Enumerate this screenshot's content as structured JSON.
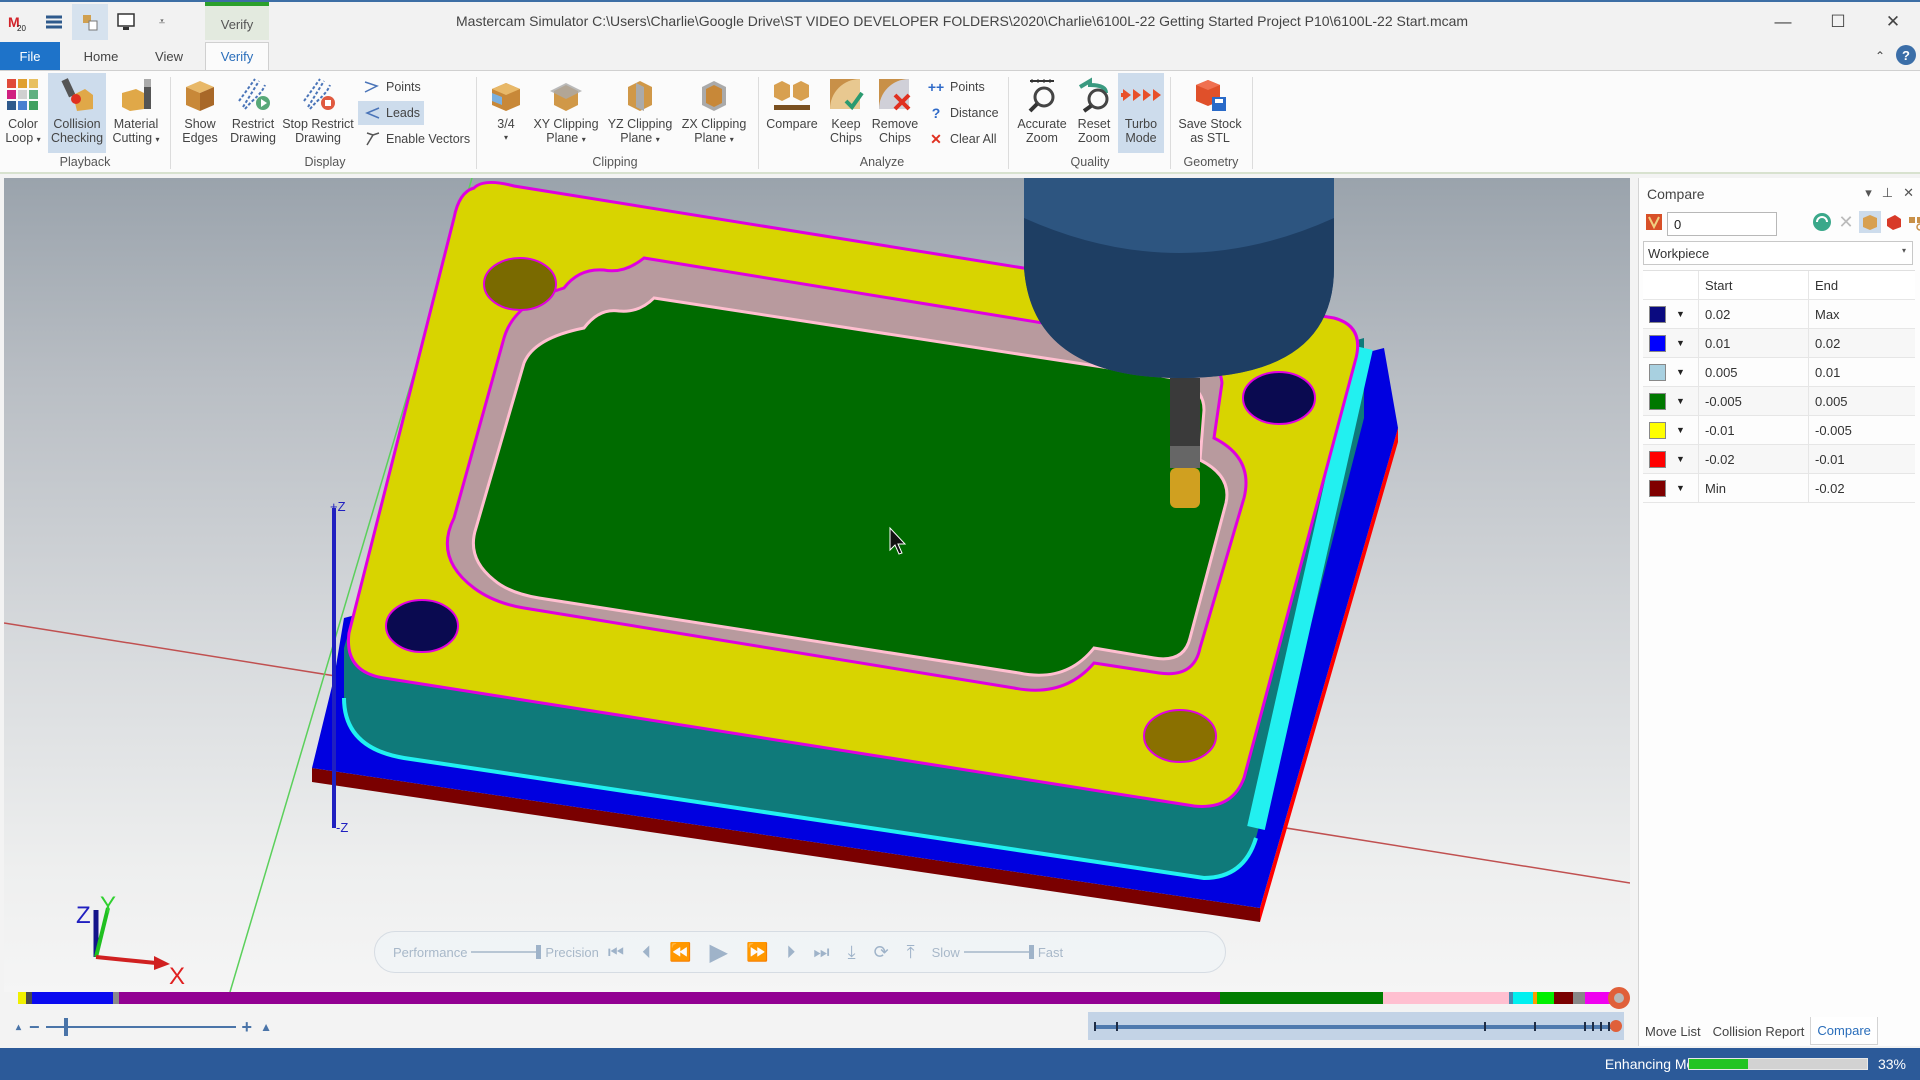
{
  "window": {
    "title": "Mastercam Simulator  C:\\Users\\Charlie\\Google Drive\\ST VIDEO DEVELOPER FOLDERS\\2020\\Charlie\\6100L-22 Getting Started Project P10\\6100L-22 Start.mcam",
    "context_tab": "Verify",
    "controls": {
      "minimize": "—",
      "maximize": "☐",
      "close": "✕"
    }
  },
  "quick_access": [
    {
      "icon": "mastercam-logo-icon"
    },
    {
      "icon": "layers-icon"
    },
    {
      "icon": "toolpath-icon"
    },
    {
      "icon": "display-icon"
    },
    {
      "icon": "customize-icon",
      "glyph": "⩡"
    }
  ],
  "menu": {
    "tabs": [
      "File",
      "Home",
      "View",
      "Verify"
    ],
    "active": "Verify",
    "collapse_glyph": "⌃",
    "help_glyph": "?"
  },
  "ribbon": {
    "groups": [
      "Playback",
      "Display",
      "Clipping",
      "Analyze",
      "Quality",
      "Geometry"
    ],
    "buttons": {
      "color_loop": [
        "Color",
        "Loop"
      ],
      "collision_checking": [
        "Collision",
        "Checking"
      ],
      "material_cutting": [
        "Material",
        "Cutting"
      ],
      "show_edges": [
        "Show",
        "Edges"
      ],
      "restrict_drawing": [
        "Restrict",
        "Drawing"
      ],
      "stop_restrict_drawing": [
        "Stop Restrict",
        "Drawing"
      ],
      "points": "Points",
      "leads": "Leads",
      "enable_vectors": "Enable Vectors",
      "three_quarter": "3/4",
      "xy_clipping": [
        "XY Clipping",
        "Plane"
      ],
      "yz_clipping": [
        "YZ Clipping",
        "Plane"
      ],
      "zx_clipping": [
        "ZX Clipping",
        "Plane"
      ],
      "compare": "Compare",
      "keep_chips": [
        "Keep",
        "Chips"
      ],
      "remove_chips": [
        "Remove",
        "Chips"
      ],
      "analyze_points": "Points",
      "distance": "Distance",
      "clear_all": "Clear All",
      "accurate_zoom": [
        "Accurate",
        "Zoom"
      ],
      "reset_zoom": [
        "Reset",
        "Zoom"
      ],
      "turbo_mode": [
        "Turbo",
        "Mode"
      ],
      "save_stock": [
        "Save Stock",
        "as STL"
      ]
    },
    "dropdown_glyph": "▾",
    "active_buttons": [
      "collision_checking",
      "leads",
      "turbo_mode"
    ]
  },
  "viewport": {
    "axis_labels": {
      "plus_z": "+Z",
      "minus_z": "-Z"
    },
    "triad": {
      "x": "X",
      "y": "Y",
      "z": "Z"
    },
    "colors": {
      "workpiece_top": "#d8d400",
      "pocket_floor": "#006b00",
      "pocket_wall": "#b89a9e",
      "side_teal": "#0f7a7a",
      "cyan": "#22f0f0",
      "blue": "#0000e0",
      "dark_red": "#7a0000",
      "red": "#ff0000",
      "magenta": "#e000e0",
      "tool_holder": "#2d5580"
    }
  },
  "playback": {
    "performance": "Performance",
    "precision": "Precision",
    "slow": "Slow",
    "fast": "Fast",
    "glyphs": [
      "⏮",
      "⏴",
      "⏪",
      "▶",
      "⏩",
      "⏵",
      "⏭",
      "⤓",
      "⟳",
      "⤒"
    ]
  },
  "timeline": {
    "segments": [
      {
        "color": "#f0f000",
        "share": 0.4
      },
      {
        "color": "#4a4a4a",
        "share": 0.3
      },
      {
        "color": "#0a0af0",
        "share": 4.2
      },
      {
        "color": "#8a8a8a",
        "share": 0.3
      },
      {
        "color": "#920092",
        "share": 56.8
      },
      {
        "color": "#007d00",
        "share": 8.4
      },
      {
        "color": "#ffbfd0",
        "share": 6.5
      },
      {
        "color": "#4a8ab0",
        "share": 0.2
      },
      {
        "color": "#00f0f0",
        "share": 1.0
      },
      {
        "color": "#ff9c00",
        "share": 0.2
      },
      {
        "color": "#00f000",
        "share": 0.9
      },
      {
        "color": "#7a0000",
        "share": 1.0
      },
      {
        "color": "#888888",
        "share": 0.6
      },
      {
        "color": "#f000f0",
        "share": 1.8
      }
    ],
    "zoom_minus": "−",
    "zoom_plus": "+"
  },
  "compare_panel": {
    "title": "Compare",
    "ctrl_glyphs": [
      "▾",
      "⊥",
      "✕"
    ],
    "value": "0",
    "dropdown": "Workpiece",
    "columns": [
      "",
      "Start",
      "End"
    ],
    "rows": [
      {
        "color": "#0a0a80",
        "start": "0.02",
        "end": "Max"
      },
      {
        "color": "#0000ff",
        "start": "0.01",
        "end": "0.02"
      },
      {
        "color": "#a8d0e0",
        "start": "0.005",
        "end": "0.01"
      },
      {
        "color": "#007800",
        "start": "-0.005",
        "end": "0.005"
      },
      {
        "color": "#ffff00",
        "start": "-0.01",
        "end": "-0.005"
      },
      {
        "color": "#ff0000",
        "start": "-0.02",
        "end": "-0.01"
      },
      {
        "color": "#800000",
        "start": "Min",
        "end": "-0.02"
      }
    ],
    "tabs": [
      "Move List",
      "Collision Report",
      "Compare"
    ],
    "active_tab": "Compare"
  },
  "status": {
    "text": "Enhancing Model",
    "progress": 0.33,
    "progress_label": "33%"
  }
}
